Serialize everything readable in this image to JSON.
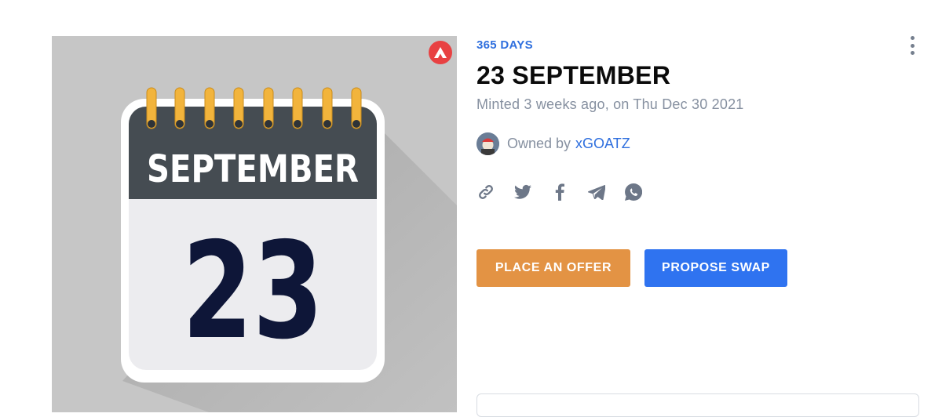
{
  "artwork": {
    "month_text": "SEPTEMBER",
    "day_text": "23"
  },
  "nft": {
    "collection": "365 DAYS",
    "title": "23 SEPTEMBER",
    "minted_text": "Minted 3 weeks ago, on Thu Dec 30 2021",
    "owned_label": "Owned by",
    "owner": "xGOATZ"
  },
  "share": {
    "icons": [
      "link-icon",
      "twitter-icon",
      "facebook-icon",
      "telegram-icon",
      "whatsapp-icon"
    ]
  },
  "actions": {
    "offer_label": "PLACE AN OFFER",
    "swap_label": "PROPOSE SWAP"
  },
  "colors": {
    "accent_blue": "#2f6fde",
    "offer_orange": "#e39344",
    "swap_blue": "#2f73f0",
    "avalanche_red": "#e84142"
  }
}
